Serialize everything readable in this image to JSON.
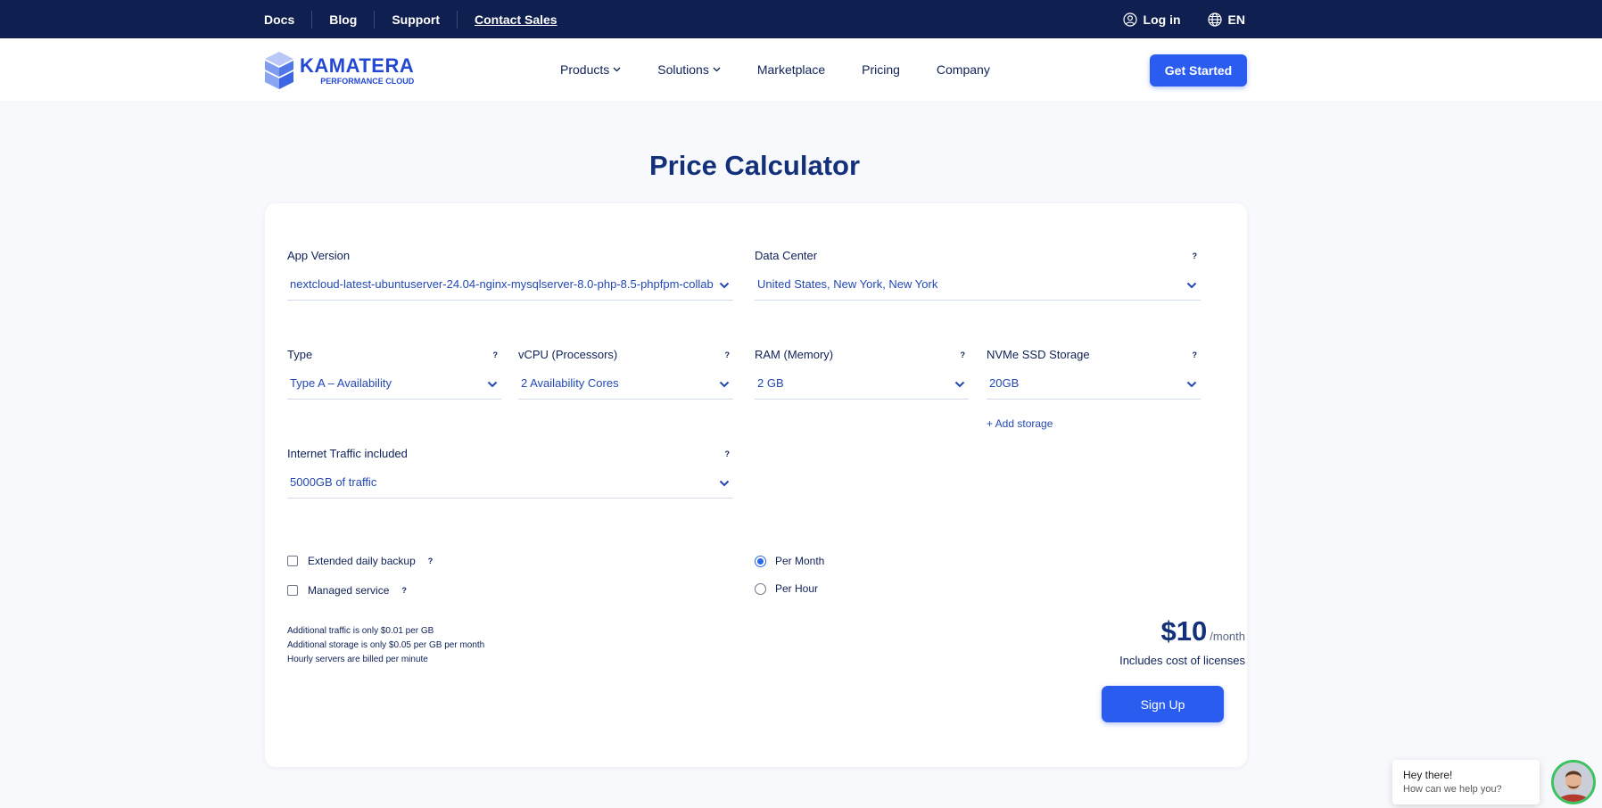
{
  "topbar": {
    "links": [
      "Docs",
      "Blog",
      "Support",
      "Contact Sales"
    ],
    "login": "Log in",
    "language": "EN"
  },
  "header": {
    "logo_name": "KAMATERA",
    "logo_tagline": "PERFORMANCE CLOUD",
    "nav": [
      "Products",
      "Solutions",
      "Marketplace",
      "Pricing",
      "Company"
    ],
    "cta": "Get Started"
  },
  "calculator": {
    "title": "Price Calculator",
    "app_version": {
      "label": "App Version",
      "value": "nextcloud-latest-ubuntuserver-24.04-nginx-mysqlserver-8.0-php-8.5-phpfpm-collab"
    },
    "data_center": {
      "label": "Data Center",
      "value": "United States, New York, New York"
    },
    "type": {
      "label": "Type",
      "value": "Type A – Availability"
    },
    "vcpu": {
      "label": "vCPU (Processors)",
      "value": "2 Availability Cores"
    },
    "ram": {
      "label": "RAM (Memory)",
      "value": "2 GB"
    },
    "storage": {
      "label": "NVMe SSD Storage",
      "value": "20GB"
    },
    "add_storage": "+ Add storage",
    "traffic": {
      "label": "Internet Traffic included",
      "value": "5000GB of traffic"
    },
    "help": "?",
    "options": {
      "backup": "Extended daily backup",
      "managed": "Managed service"
    },
    "billing": {
      "per_month": "Per Month",
      "per_hour": "Per Hour",
      "selected": "Per Month"
    },
    "notes": [
      "Additional traffic is only $0.01 per GB",
      "Additional storage is only $0.05 per GB per month",
      "Hourly servers are billed per minute"
    ],
    "price": "$10",
    "period": "/month",
    "includes": "Includes cost of licenses",
    "signup": "Sign Up"
  },
  "chat": {
    "greeting": "Hey there!",
    "subtitle": "How can we help you?"
  },
  "colors": {
    "navy": "#0f1f4f",
    "brand_blue": "#2a5cf0",
    "value_blue": "#2348b4"
  }
}
